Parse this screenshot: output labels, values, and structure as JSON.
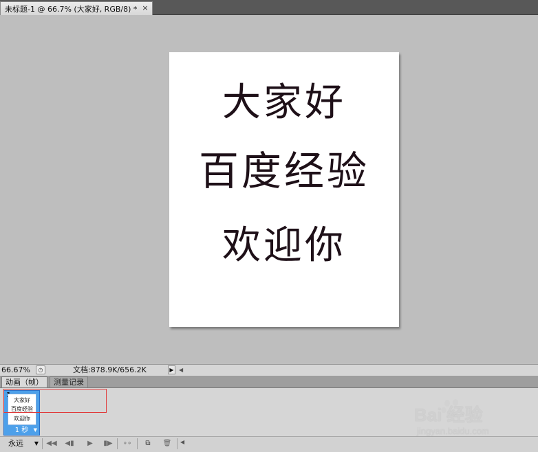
{
  "document_tab": {
    "title": "未标题-1 @ 66.7% (大家好, RGB/8) *",
    "close_label": "×"
  },
  "canvas": {
    "lines": [
      "大家好",
      "百度经验",
      "欢迎你"
    ]
  },
  "status_bar": {
    "zoom": "66.67%",
    "doc_size": "文档:878.9K/656.2K",
    "menu_arrow": "▶",
    "scroll_left_arrow": "◀"
  },
  "panel": {
    "tabs": [
      {
        "label": "动画（帧）",
        "active": true
      },
      {
        "label": "测量记录",
        "active": false
      }
    ],
    "frames": [
      {
        "number": "1",
        "thumb_lines": [
          "大家好",
          "百度经验",
          "欢迎你"
        ],
        "delay": "1 秒"
      }
    ]
  },
  "toolbar": {
    "loop_value": "永远",
    "buttons": [
      {
        "icon": "first-frame-icon",
        "glyph": "◀◀"
      },
      {
        "icon": "previous-frame-icon",
        "glyph": "◀▮"
      },
      {
        "icon": "play-icon",
        "glyph": "▶"
      },
      {
        "icon": "next-frame-icon",
        "glyph": "▮▶"
      },
      {
        "icon": "tween-icon",
        "glyph": "∘∘"
      },
      {
        "icon": "duplicate-frame-icon",
        "glyph": "⧉"
      },
      {
        "icon": "trash-icon",
        "glyph": "🗑"
      }
    ]
  },
  "watermark": {
    "logo_text": "Bai 经验",
    "url": "jingyan.baidu.com"
  },
  "colors": {
    "selection_blue": "#4da0ea",
    "highlight_red": "#e03a3a",
    "canvas_gray": "#bebebe"
  }
}
